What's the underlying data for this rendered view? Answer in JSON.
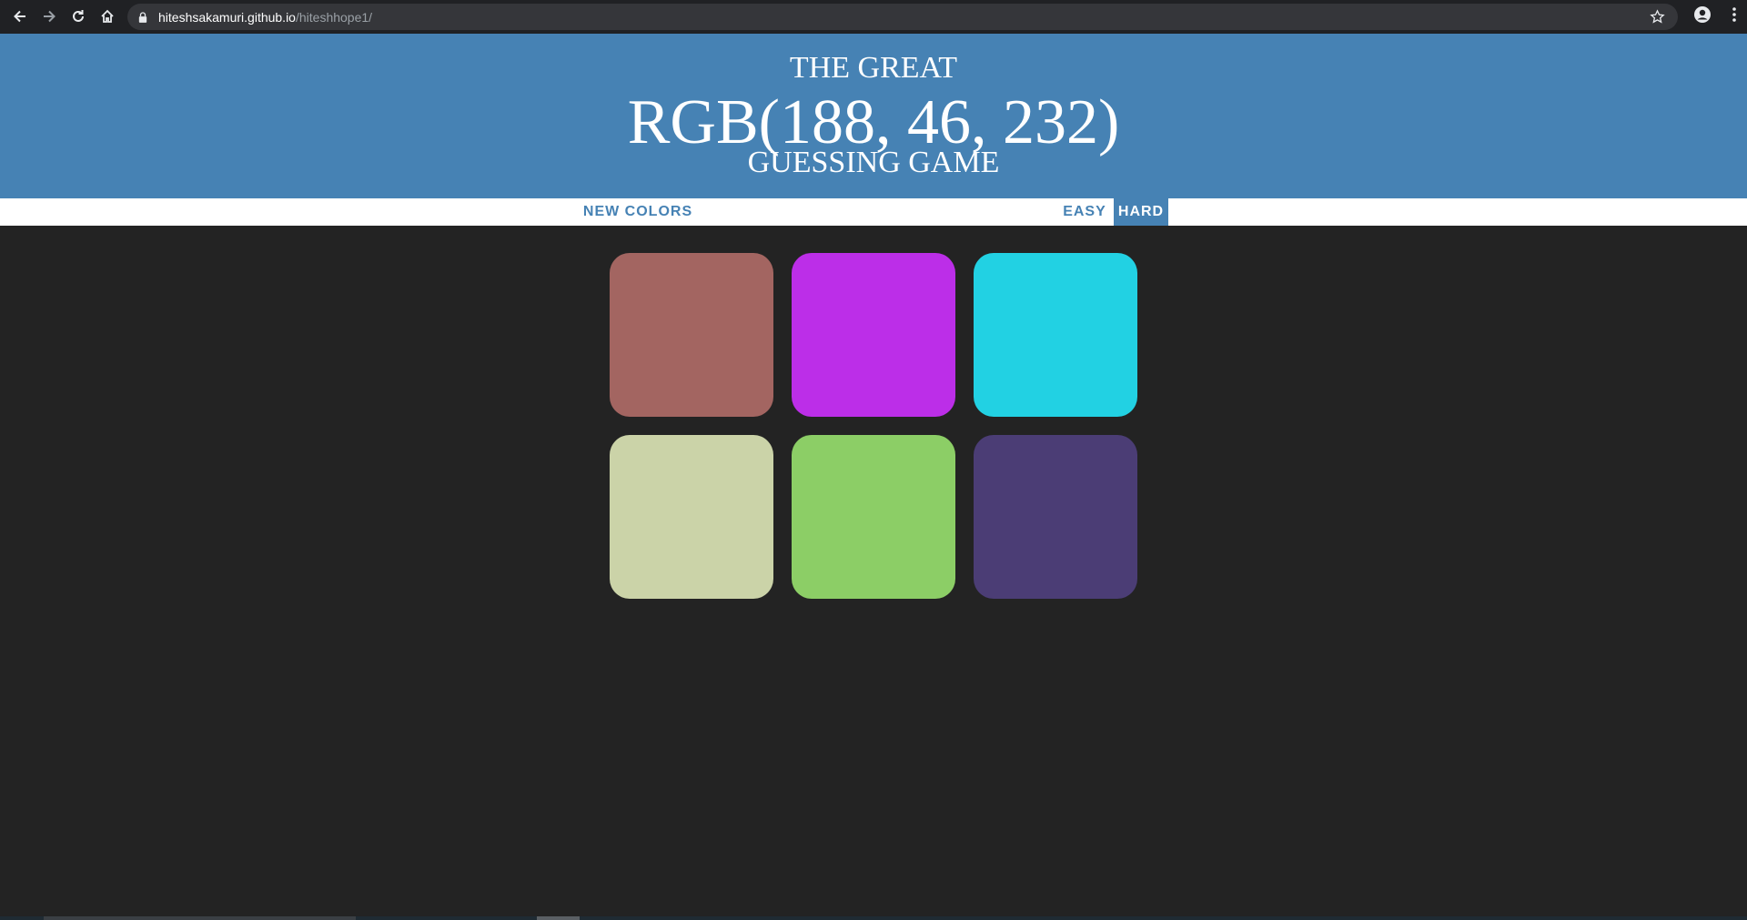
{
  "browser": {
    "url_host": "hiteshsakamuri.github.io",
    "url_path": "/hiteshhope1/",
    "icons": [
      "back-arrow-icon",
      "forward-arrow-icon",
      "reload-icon",
      "home-icon",
      "lock-icon",
      "star-icon",
      "account-icon",
      "menu-dots-icon"
    ]
  },
  "header": {
    "line1": "THE GREAT",
    "target_color": "RGB(188, 46, 232)",
    "line3": "GUESSING GAME",
    "background": "#4682b4"
  },
  "controls": {
    "new_colors": "NEW COLORS",
    "easy": "EASY",
    "hard": "HARD",
    "selected_mode": "HARD",
    "accent": "#4682b4"
  },
  "squares": [
    {
      "color": "#a36561"
    },
    {
      "color": "#bc2ee8"
    },
    {
      "color": "#22d1e3"
    },
    {
      "color": "#cbd3a8"
    },
    {
      "color": "#8cce66"
    },
    {
      "color": "#4b3d75"
    }
  ],
  "colors": {
    "page_background": "#232323"
  }
}
